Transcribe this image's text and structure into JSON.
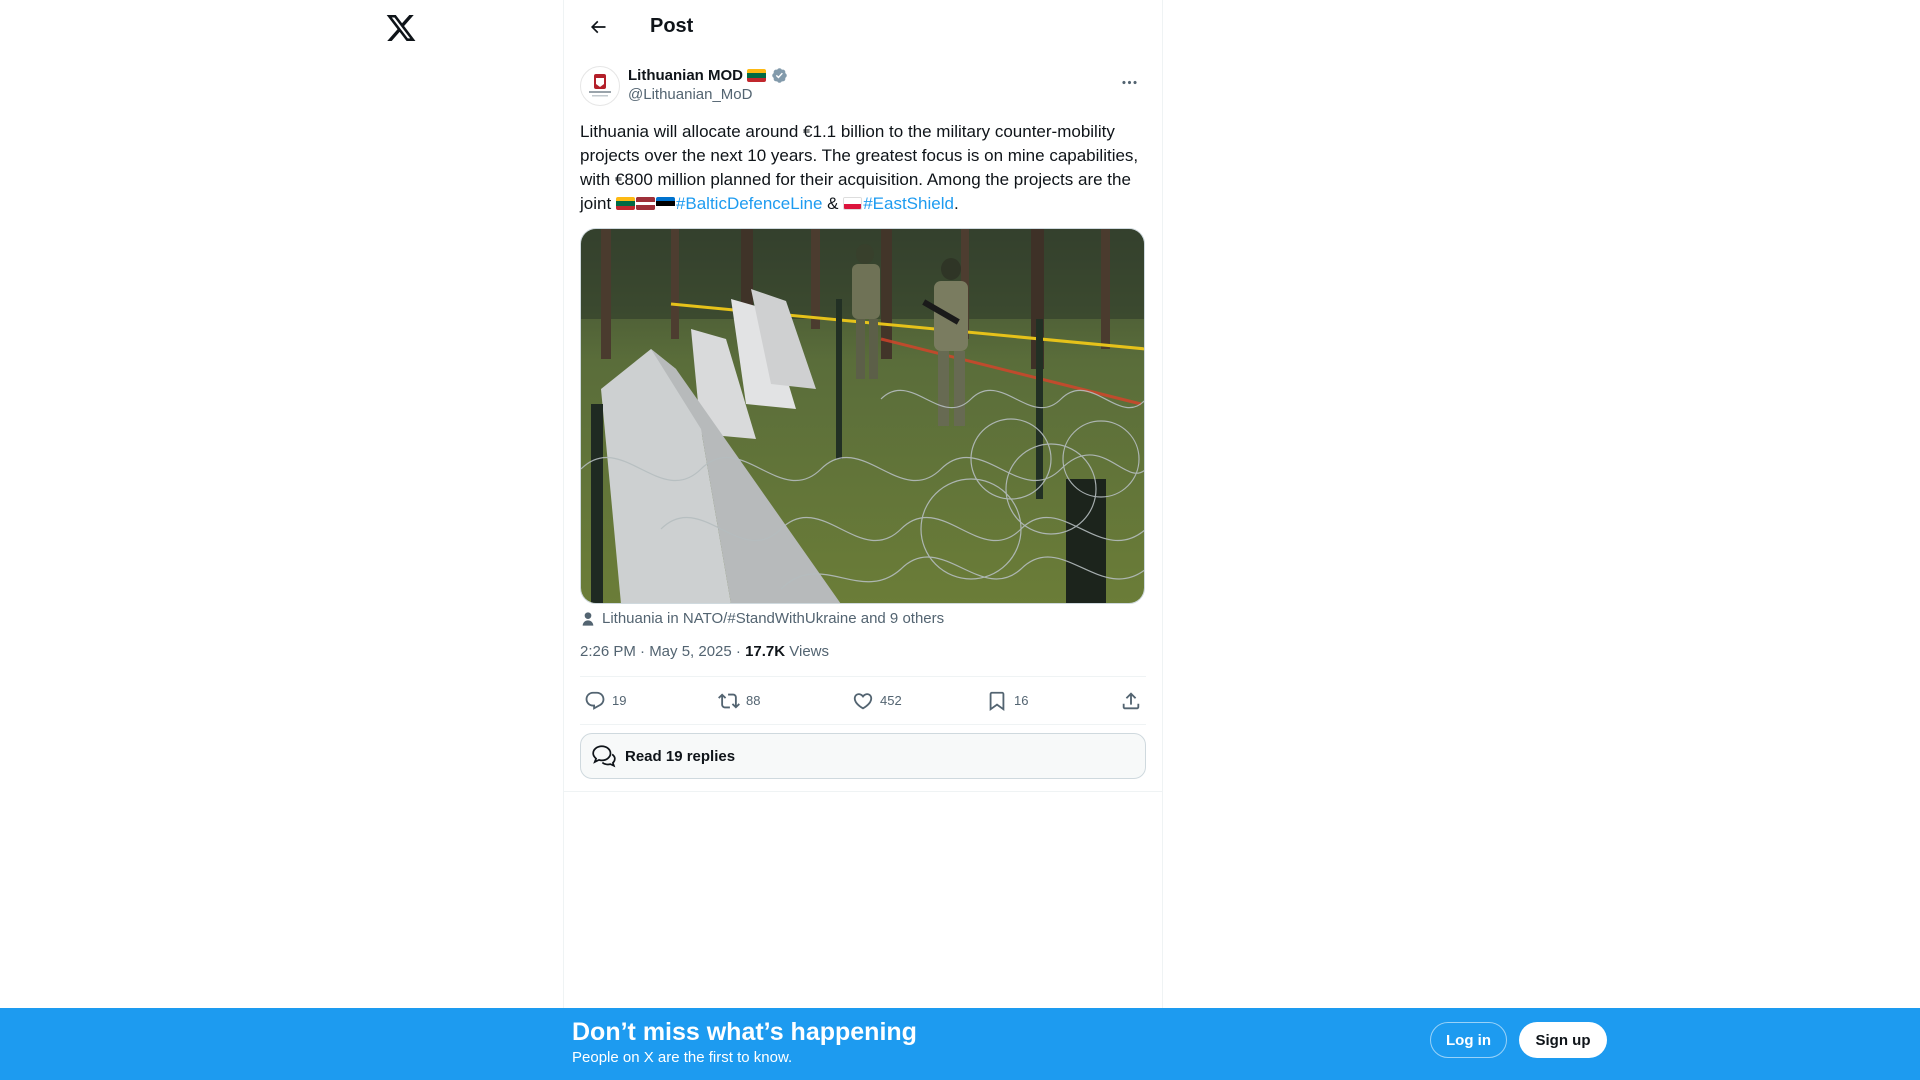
{
  "header": {
    "title": "Post"
  },
  "tweet": {
    "display_name": "Lithuanian MOD",
    "handle": "@Lithuanian_MoD",
    "text_intro": "Lithuania will allocate around €1.1 billion to the military counter-mobility projects over the next 10 years. The greatest focus is on mine capabilities, with €800 million planned for their acquisition. Among the projects are the joint ",
    "hashtag_1": "#BalticDefenceLine",
    "text_and": " & ",
    "hashtag_2": "#EastShield",
    "text_end": ".",
    "tagged": "Lithuania in NATO/#StandWithUkraine and 9 others",
    "timestamp": "2:26 PM · May 5, 2025 · ",
    "views_count": "17.7K",
    "views_label": " Views"
  },
  "actions": {
    "replies": "19",
    "reposts": "88",
    "likes": "452",
    "bookmarks": "16"
  },
  "read_replies": "Read 19 replies",
  "banner": {
    "title": "Don’t miss what’s happening",
    "subtitle": "People on X are the first to know.",
    "login": "Log in",
    "signup": "Sign up"
  },
  "colors": {
    "accent": "#1d9bf0",
    "verified": "#829aab",
    "text": "#0f1419",
    "muted": "#536471"
  }
}
